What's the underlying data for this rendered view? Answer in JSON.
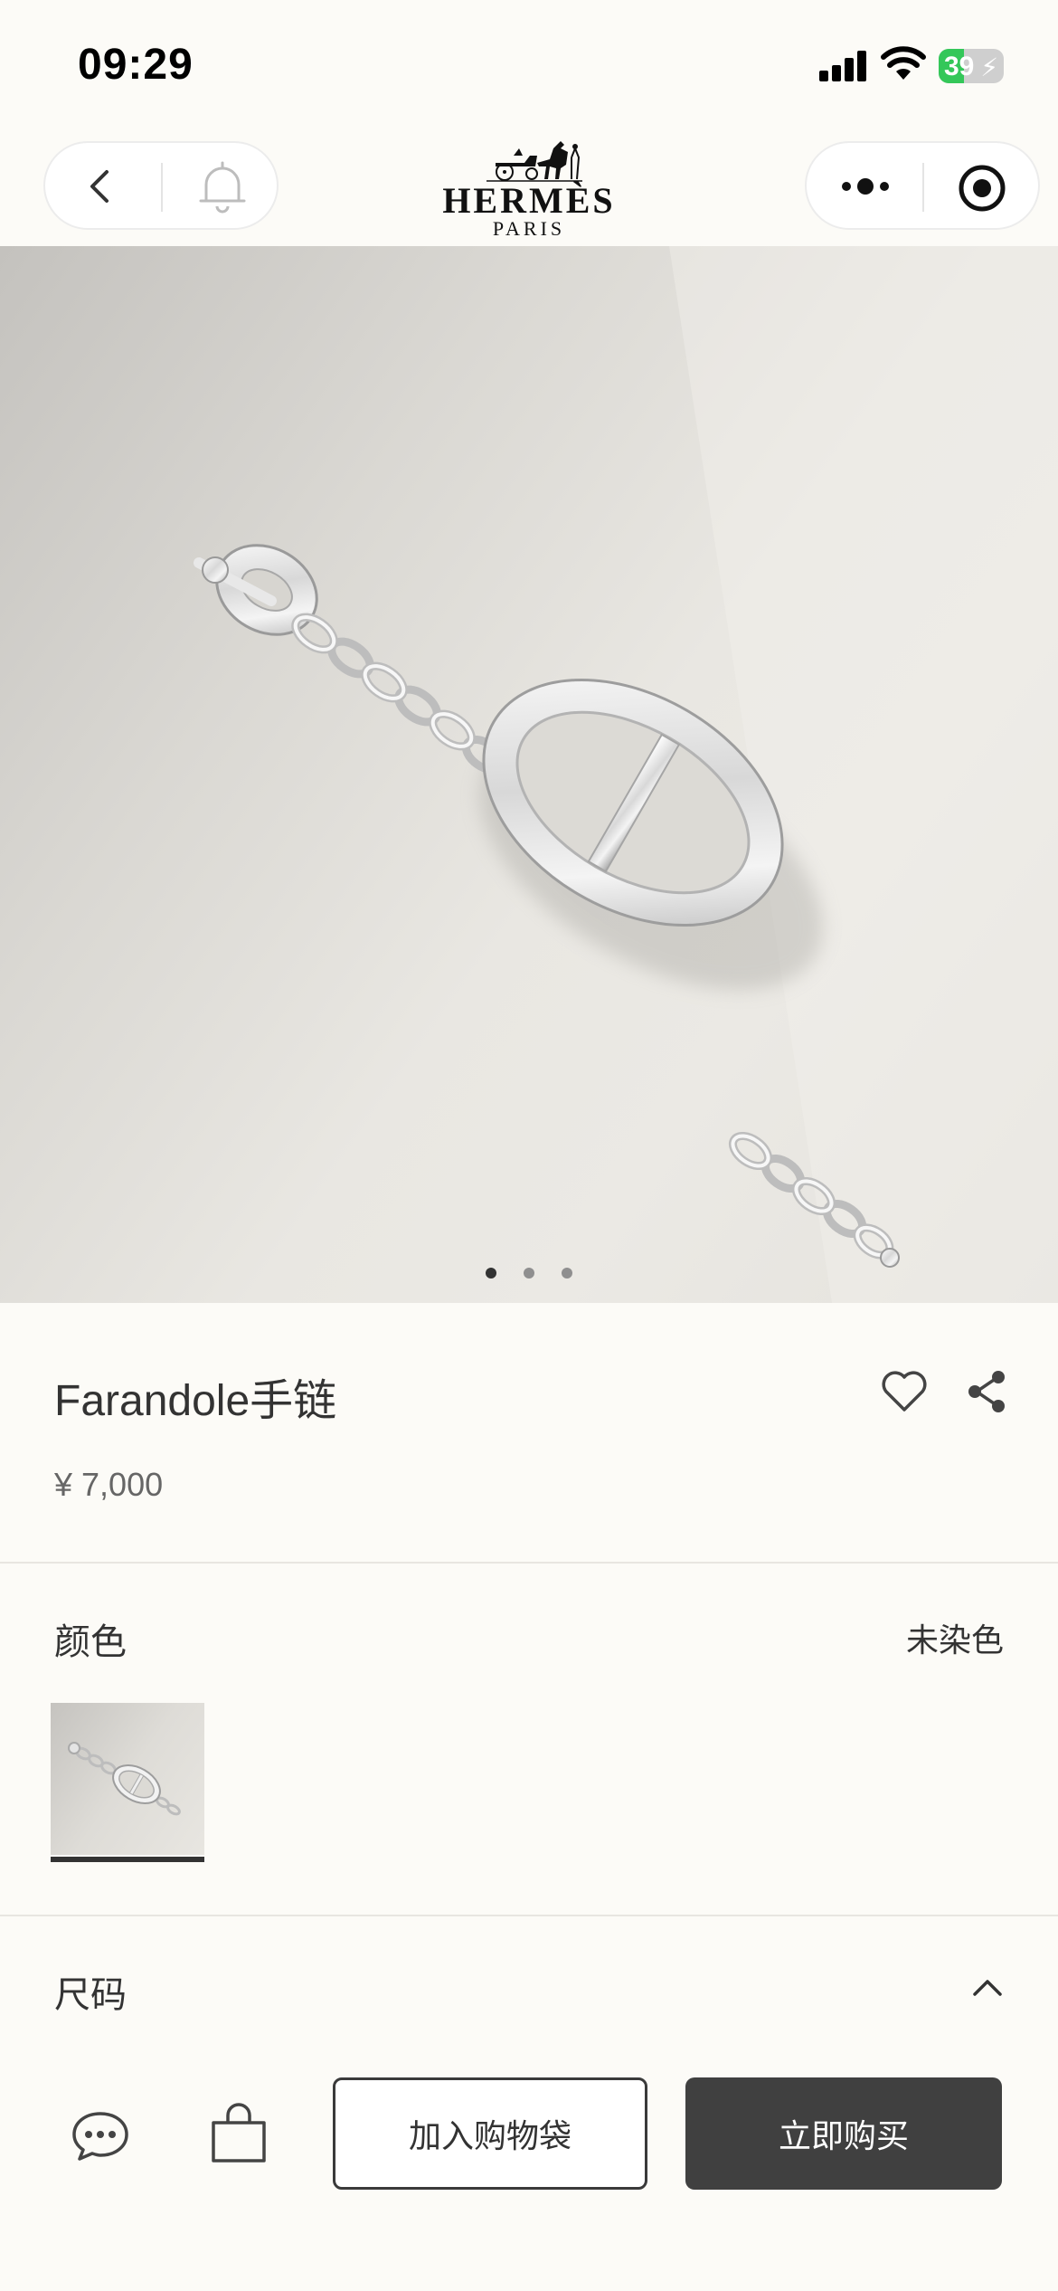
{
  "status_bar": {
    "time": "09:29",
    "battery": "39",
    "battery_level": 0.39
  },
  "nav": {
    "brand_name": "HERMÈS",
    "brand_city": "PARIS"
  },
  "gallery": {
    "page_count": 3,
    "current_page": 1
  },
  "product": {
    "title": "Farandole手链",
    "price": "¥ 7,000"
  },
  "color_section": {
    "label": "颜色",
    "value": "未染色"
  },
  "size_section": {
    "label": "尺码"
  },
  "bottom_bar": {
    "add_to_bag_label": "加入购物袋",
    "buy_now_label": "立即购买"
  },
  "icons": {
    "back": "chevron-left-icon",
    "bell": "bell-icon",
    "more": "more-dots-icon",
    "close": "target-close-icon",
    "favorite": "heart-icon",
    "share": "share-icon",
    "chat": "chat-bubble-icon",
    "bag": "shopping-bag-icon",
    "collapse": "chevron-up-icon"
  }
}
